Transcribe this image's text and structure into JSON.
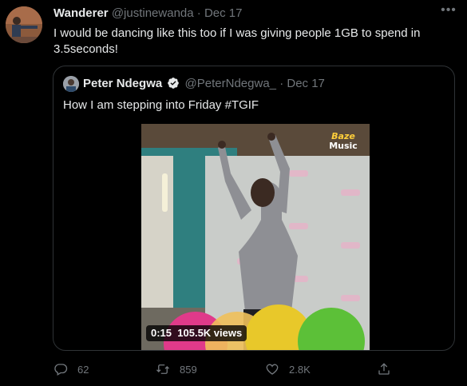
{
  "author": {
    "name": "Wanderer",
    "handle": "@justinewanda",
    "separator": "·",
    "date": "Dec 17",
    "avatar_icon": "avatar"
  },
  "tweet_text": "I would be dancing like this too if I was giving people 1GB to spend in 3.5seconds!",
  "more_icon": "more-icon",
  "quoted": {
    "name": "Peter Ndegwa",
    "handle": "@PeterNdegwa_",
    "separator": "·",
    "date": "Dec 17",
    "text": "How I am stepping into Friday #TGIF",
    "verified_color": "#e7e9ea",
    "media": {
      "brand_line1": "Baze",
      "brand_line2": "Music",
      "time": "0:15",
      "views": "105.5K views"
    }
  },
  "actions": {
    "reply_count": "62",
    "retweet_count": "859",
    "like_count": "2.8K"
  },
  "colors": {
    "background": "#000000",
    "text": "#e7e9ea",
    "secondary": "#71767b",
    "border": "#2f3336"
  }
}
